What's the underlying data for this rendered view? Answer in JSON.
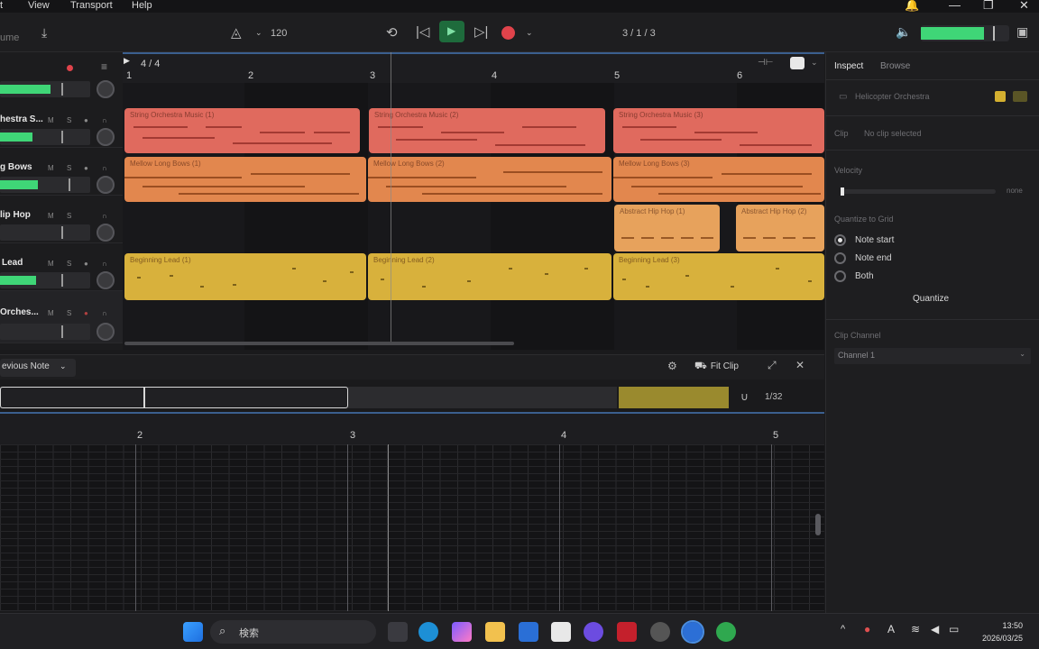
{
  "menu": {
    "items": [
      "t",
      "View",
      "Transport",
      "Help"
    ]
  },
  "toolbar": {
    "left_label": "ume",
    "tempo": "120",
    "position": "3 / 1 / 3",
    "accent": "#3fd677",
    "record_color": "#e0434b"
  },
  "arrangement": {
    "time_signature": "4 / 4",
    "bars": [
      "1",
      "2",
      "3",
      "4",
      "5",
      "6"
    ],
    "tracks": [
      {
        "name": "",
        "level": 0.42
      },
      {
        "name": "hestra S...",
        "level": 0.34
      },
      {
        "name": "g Bows",
        "level": 0.42
      },
      {
        "name": "lip Hop",
        "level": 0.0
      },
      {
        "name": "Lead",
        "level": 0.4
      },
      {
        "name": "Orches...",
        "level": 0.0
      }
    ],
    "clips": {
      "red": [
        "String Orchestra Music (1)",
        "String Orchestra Music (2)",
        "String Orchestra Music (3)"
      ],
      "orange": [
        "Mellow Long Bows (1)",
        "Mellow Long Bows (2)",
        "Mellow Long Bows (3)"
      ],
      "hiphop": [
        "Abstract Hip Hop (1)",
        "Abstract Hip Hop (2)"
      ],
      "yellow": [
        "Beginning Lead (1)",
        "Beginning Lead (2)",
        "Beginning Lead (3)"
      ]
    }
  },
  "editor": {
    "dropdown": "evious Note",
    "fit_clip": "Fit Clip",
    "quantize_value": "1/32",
    "bars": [
      "2",
      "3",
      "4",
      "5"
    ]
  },
  "right_panel": {
    "tab_inspect": "Inspect",
    "tab_browse": "Browse",
    "instrument": "Helicopter Orchestra",
    "clip_label": "Clip",
    "clip_value": "No clip selected",
    "velocity_label": "Velocity",
    "velocity_value": "none",
    "quantize_label": "Quantize to Grid",
    "options": [
      "Note start",
      "Note end",
      "Both"
    ],
    "selected_option": "Note start",
    "quantize_button": "Quantize",
    "clip_channel_label": "Clip Channel",
    "clip_channel_value": "Channel 1"
  },
  "taskbar": {
    "search": "検索",
    "time": "13:50",
    "date": "2026/03/25"
  }
}
